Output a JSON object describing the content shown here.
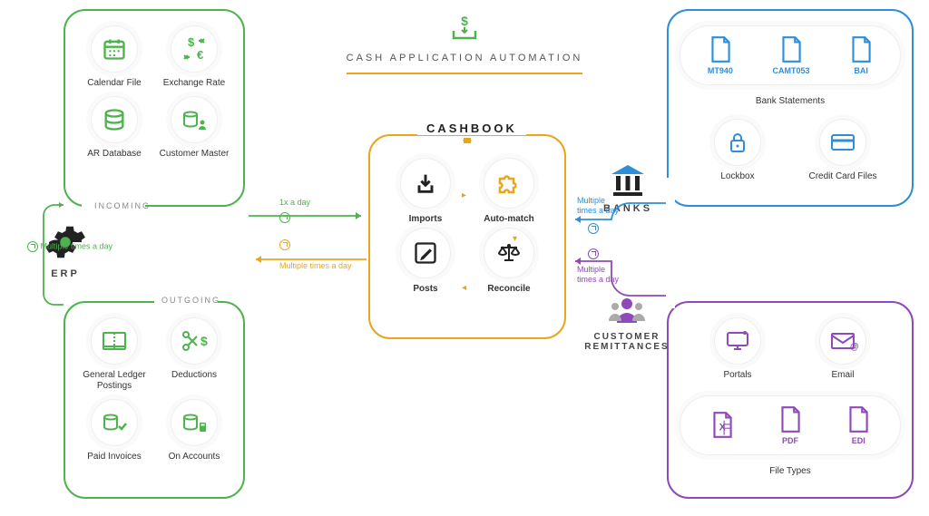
{
  "header": {
    "title": "CASH APPLICATION AUTOMATION"
  },
  "erp": {
    "title": "ERP",
    "incoming_label": "INCOMING",
    "outgoing_label": "OUTGOING",
    "incoming": [
      {
        "label": "Calendar File",
        "icon": "calendar"
      },
      {
        "label": "Exchange Rate",
        "icon": "exchange"
      },
      {
        "label": "AR Database",
        "icon": "database"
      },
      {
        "label": "Customer Master",
        "icon": "db-user"
      }
    ],
    "outgoing": [
      {
        "label": "General Ledger Postings",
        "icon": "ledger"
      },
      {
        "label": "Deductions",
        "icon": "scissors"
      },
      {
        "label": "Paid Invoices",
        "icon": "db-check"
      },
      {
        "label": "On Accounts",
        "icon": "db-calc"
      }
    ]
  },
  "cashbook": {
    "title": "CASHBOOK",
    "steps": [
      {
        "label": "Imports",
        "icon": "import"
      },
      {
        "label": "Auto-match",
        "icon": "puzzle"
      },
      {
        "label": "Posts",
        "icon": "edit"
      },
      {
        "label": "Reconcile",
        "icon": "scales"
      }
    ]
  },
  "banks": {
    "title": "BANKS",
    "statements_label": "Bank Statements",
    "statements": [
      {
        "label": "MT940"
      },
      {
        "label": "CAMT053"
      },
      {
        "label": "BAI"
      }
    ],
    "items": [
      {
        "label": "Lockbox",
        "icon": "lock"
      },
      {
        "label": "Credit Card Files",
        "icon": "card"
      }
    ]
  },
  "remittances": {
    "title": "CUSTOMER REMITTANCES",
    "items": [
      {
        "label": "Portals",
        "icon": "monitor"
      },
      {
        "label": "Email",
        "icon": "mail"
      }
    ],
    "filetypes_label": "File Types",
    "filetypes": [
      {
        "label": "X",
        "icon": "excel"
      },
      {
        "label": "PDF"
      },
      {
        "label": "EDI"
      }
    ]
  },
  "flows": {
    "erp_loop": "Multiple times a day",
    "erp_to_cb": "1x  a day",
    "cb_to_erp": "Multiple times a day",
    "banks_to_cb": "Multiple times a day",
    "remit_to_cb": "Multiple times a day"
  },
  "colors": {
    "green": "#4eb34e",
    "orange": "#e8a61c",
    "blue": "#2d8fd8",
    "purple": "#8d4ab8"
  }
}
